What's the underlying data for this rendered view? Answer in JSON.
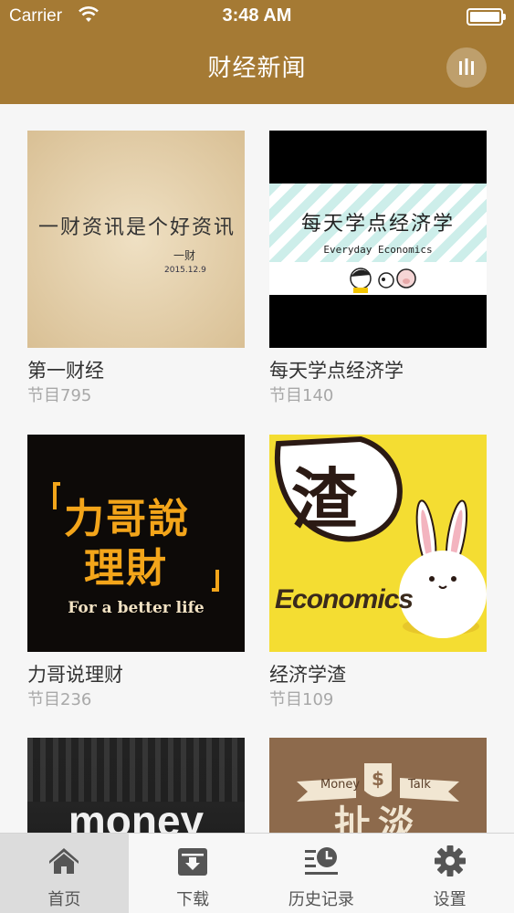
{
  "status": {
    "carrier": "Carrier",
    "time": "3:48 AM"
  },
  "nav": {
    "title": "财经新闻",
    "player_icon": "audio-bars-icon"
  },
  "colors": {
    "brand": "#a57a34",
    "tab_active_bg": "#dcdcdc"
  },
  "programs": [
    {
      "title": "第一财经",
      "count": "节目795",
      "cover": {
        "handwriting": "一财资讯是个好资讯",
        "signature": "一财",
        "date": "2015.12.9"
      }
    },
    {
      "title": "每天学点经济学",
      "count": "节目140",
      "cover": {
        "headline": "每天学点经济学",
        "subtitle": "Everyday Economics"
      }
    },
    {
      "title": "力哥说理财",
      "count": "节目236",
      "cover": {
        "line1": "力哥說",
        "line2": "理財",
        "tagline": "For a better life"
      }
    },
    {
      "title": "经济学渣",
      "count": "节目109",
      "cover": {
        "glyph": "渣",
        "word": "Economics"
      }
    },
    {
      "title": "",
      "count": "",
      "cover": {
        "word": "money"
      }
    },
    {
      "title": "",
      "count": "",
      "cover": {
        "left": "Money",
        "right": "Talk",
        "glyph": "扯淡"
      }
    }
  ],
  "tabs": [
    {
      "label": "首页",
      "icon": "home-icon",
      "active": true
    },
    {
      "label": "下载",
      "icon": "download-box-icon",
      "active": false
    },
    {
      "label": "历史记录",
      "icon": "history-icon",
      "active": false
    },
    {
      "label": "设置",
      "icon": "gear-icon",
      "active": false
    }
  ]
}
